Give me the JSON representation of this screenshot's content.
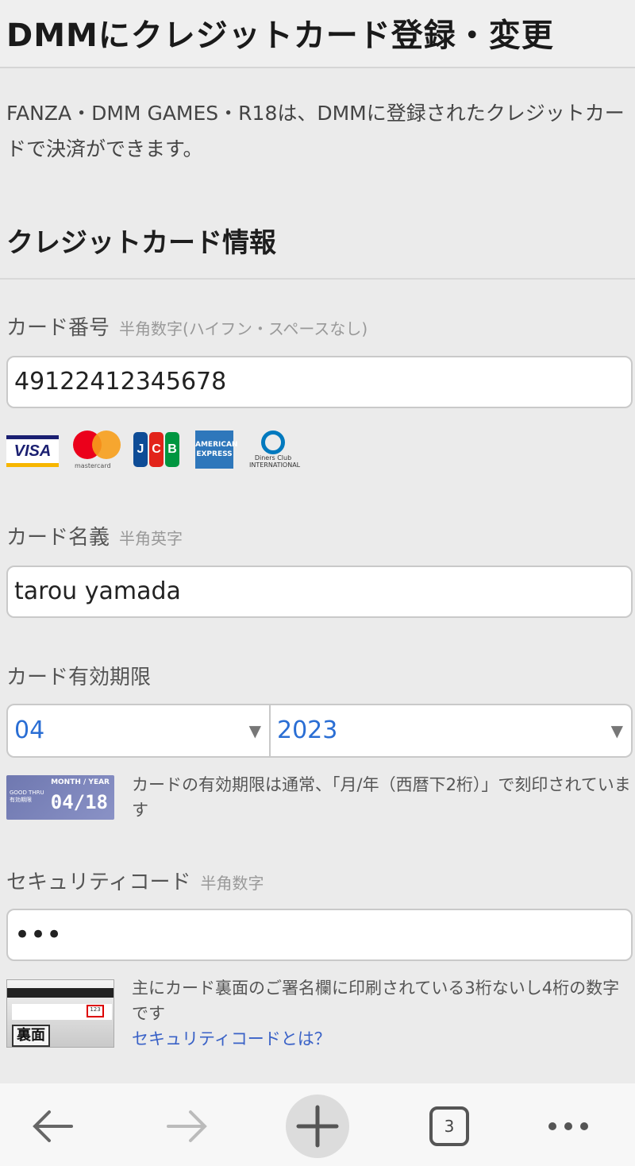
{
  "header": {
    "title": "DMMにクレジットカード登録・変更"
  },
  "intro": "FANZA・DMM GAMES・R18は、DMMに登録されたクレジットカードで決済ができます。",
  "section_title": "クレジットカード情報",
  "card_number": {
    "label": "カード番号",
    "hint": "半角数字(ハイフン・スペースなし)",
    "value": "49122412345678"
  },
  "brands": {
    "visa": "VISA",
    "mastercard": "mastercard",
    "jcb": [
      "J",
      "C",
      "B"
    ],
    "amex": "AMERICAN EXPRESS",
    "diners": "Diners Club INTERNATIONAL"
  },
  "card_name": {
    "label": "カード名義",
    "hint": "半角英字",
    "value": "tarou yamada"
  },
  "expiry": {
    "label": "カード有効期限",
    "month": "04",
    "year": "2023",
    "sample_header": "MONTH / YEAR",
    "sample_good": "GOOD THRU 有効期限",
    "sample_date": "04/18",
    "help": "カードの有効期限は通常、「月/年（西暦下2桁）」で刻印されています"
  },
  "security": {
    "label": "セキュリティコード",
    "hint": "半角数字",
    "value": "•••",
    "back_label": "裏面",
    "sample_num": "123",
    "help": "主にカード裏面のご署名欄に印刷されている3桁ないし4桁の数字です",
    "link": "セキュリティコードとは？"
  },
  "toolbar": {
    "tabs_count": "3"
  }
}
